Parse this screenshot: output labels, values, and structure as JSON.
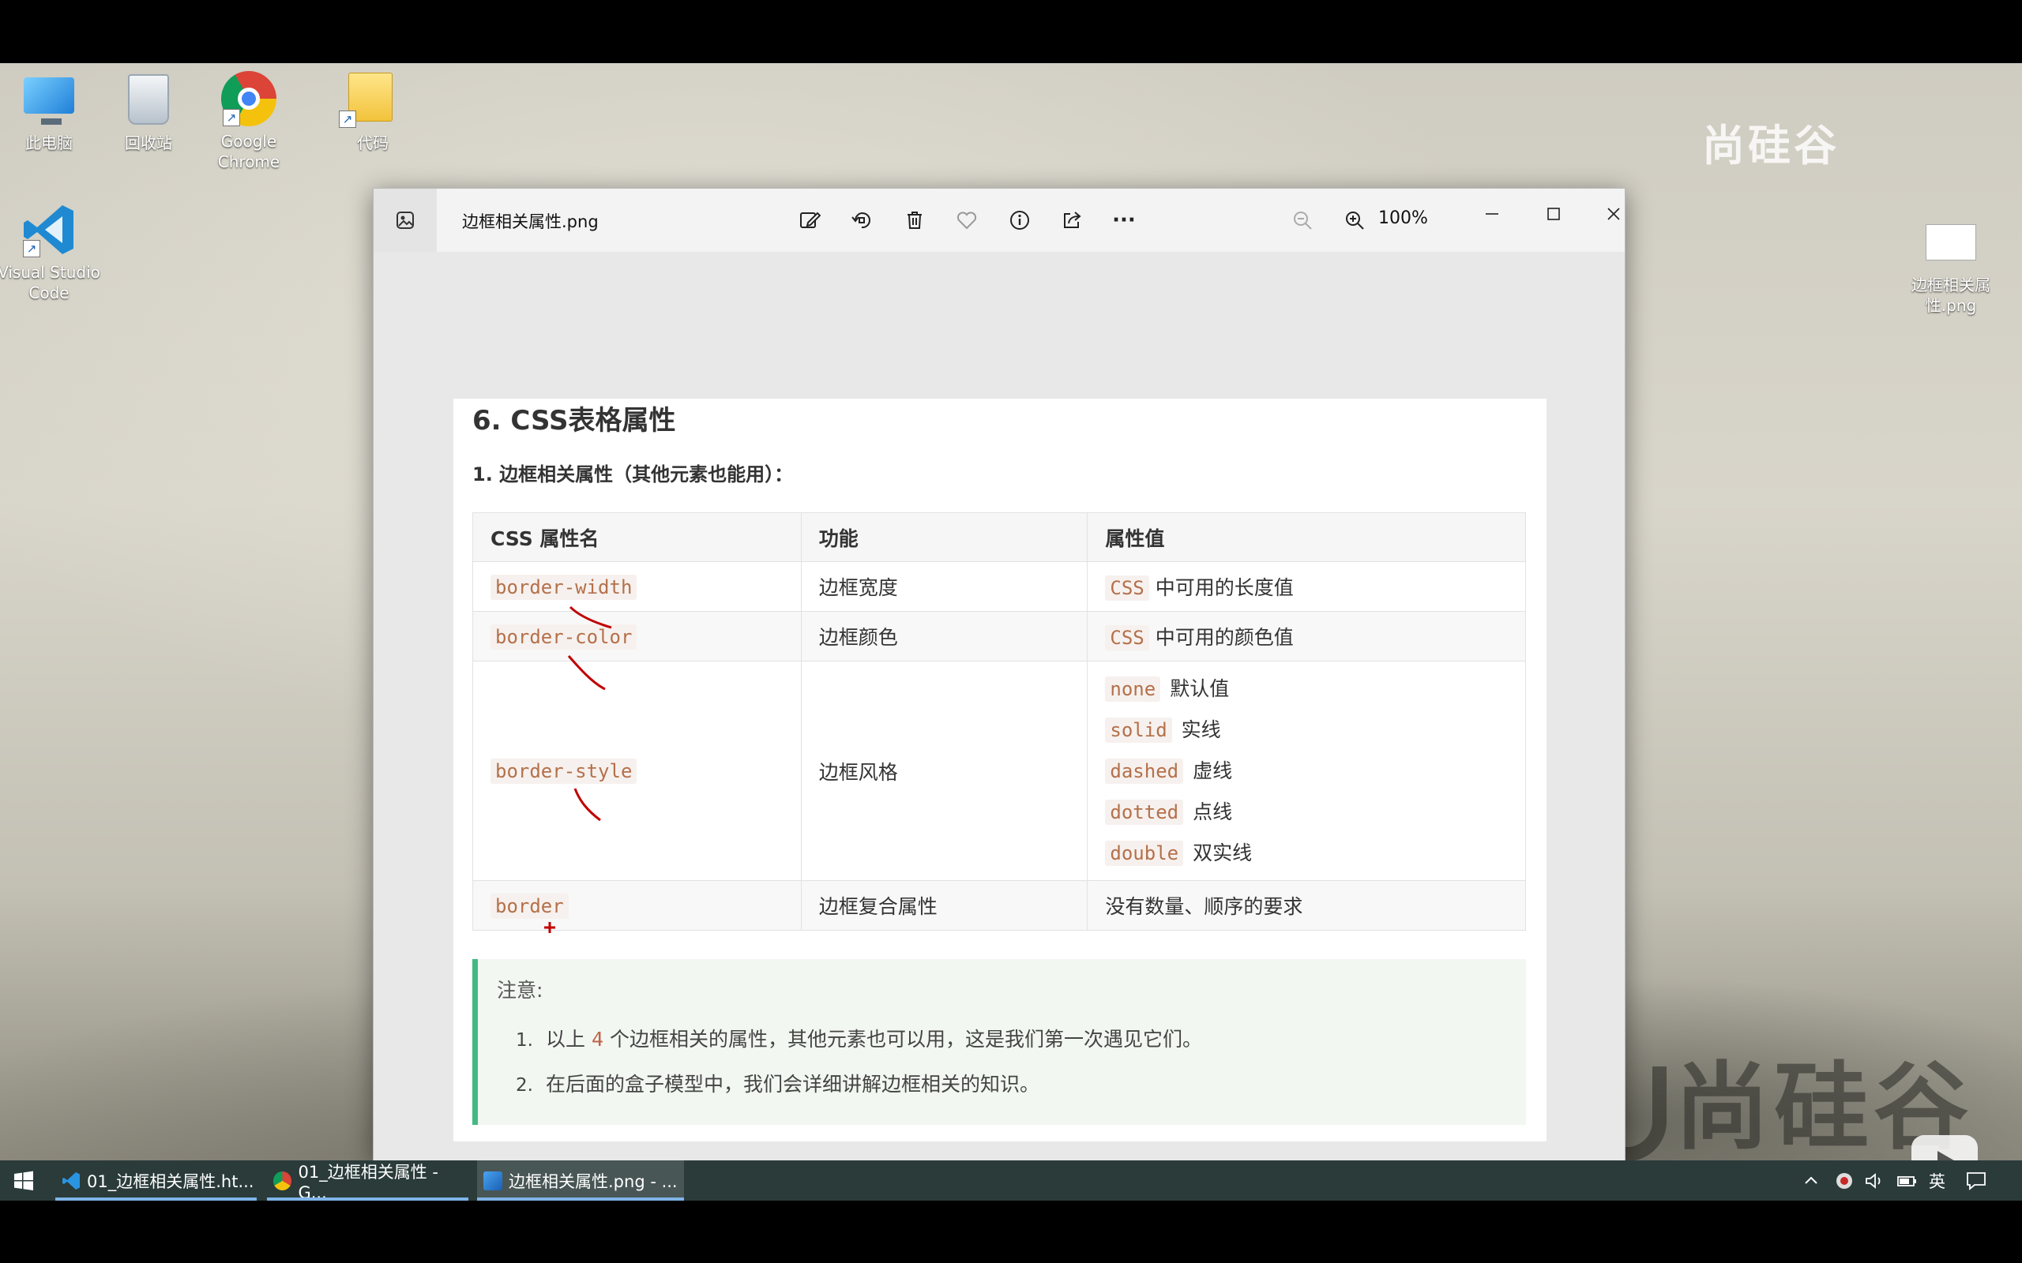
{
  "desktop": {
    "icons": [
      {
        "label": "此电脑"
      },
      {
        "label": "回收站"
      },
      {
        "label": "Google Chrome"
      },
      {
        "label": "代码"
      },
      {
        "label": "Visual Studio Code"
      },
      {
        "label": "边框相关属性.png"
      }
    ],
    "watermark_top": "尚硅谷",
    "watermark_bottom": "尚硅谷"
  },
  "viewer": {
    "title": "边框相关属性.png",
    "zoom": "100%",
    "toolbar_icons": [
      "edit-image-icon",
      "rotate-icon",
      "delete-icon",
      "favorite-icon",
      "info-icon",
      "share-icon",
      "more-icon"
    ],
    "more_label": "···"
  },
  "document": {
    "heading": "6. CSS表格属性",
    "subheading": "1. 边框相关属性（其他元素也能用）：",
    "table": {
      "headers": [
        "CSS 属性名",
        "功能",
        "属性值"
      ],
      "rows": [
        {
          "name": "border-width",
          "function": "边框宽度",
          "value_code": "CSS",
          "value_text": "中可用的长度值"
        },
        {
          "name": "border-color",
          "function": "边框颜色",
          "value_code": "CSS",
          "value_text": "中可用的颜色值"
        },
        {
          "name": "border-style",
          "function": "边框风格",
          "values": [
            {
              "code": "none",
              "text": "默认值"
            },
            {
              "code": "solid",
              "text": "实线"
            },
            {
              "code": "dashed",
              "text": "虚线"
            },
            {
              "code": "dotted",
              "text": "点线"
            },
            {
              "code": "double",
              "text": "双实线"
            }
          ]
        },
        {
          "name": "border",
          "function": "边框复合属性",
          "value_text": "没有数量、顺序的要求"
        }
      ]
    },
    "note": {
      "title": "注意:",
      "items": [
        {
          "num": "1.",
          "before": "以上",
          "highlight": "4",
          "after": "个边框相关的属性，其他元素也可以用，这是我们第一次遇见它们。"
        },
        {
          "num": "2.",
          "text": "在后面的盒子模型中，我们会详细讲解边框相关的知识。"
        }
      ]
    }
  },
  "taskbar": {
    "items": [
      {
        "label": "01_边框相关属性.ht..."
      },
      {
        "label": "01_边框相关属性 - G..."
      },
      {
        "label": "边框相关属性.png - ..."
      }
    ],
    "ime": "英"
  },
  "colors": {
    "code_text": "#b5704a",
    "note_border": "#42b983",
    "taskbar": "#2a3b3a",
    "annotation": "#c00000"
  }
}
